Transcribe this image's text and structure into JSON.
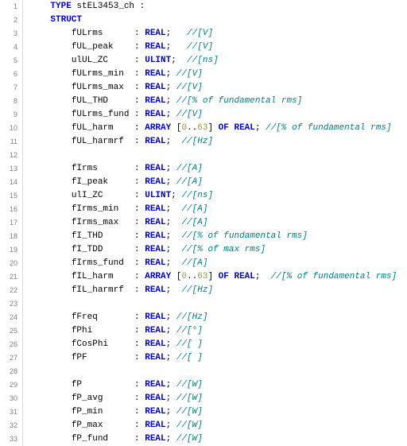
{
  "header": {
    "kw_type": "TYPE",
    "type_name": "stEL3453_ch",
    "colon": " :",
    "kw_struct": "STRUCT"
  },
  "lines": [
    {
      "name": "fULrms",
      "decl": ": ",
      "dtype": "REAL",
      "after": ";   ",
      "cmt": "//[V]"
    },
    {
      "name": "fUL_peak",
      "decl": ": ",
      "dtype": "REAL",
      "after": ";   ",
      "cmt": "//[V]"
    },
    {
      "name": "ulUL_ZC",
      "decl": ": ",
      "dtype": "ULINT",
      "after": ";  ",
      "cmt": "//[ns]"
    },
    {
      "name": "fULrms_min",
      "decl": ": ",
      "dtype": "REAL",
      "after": "; ",
      "cmt": "//[V]"
    },
    {
      "name": "fULrms_max",
      "decl": ": ",
      "dtype": "REAL",
      "after": "; ",
      "cmt": "//[V]"
    },
    {
      "name": "fUL_THD",
      "decl": ": ",
      "dtype": "REAL",
      "after": "; ",
      "cmt": "//[% of fundamental rms]"
    },
    {
      "name": "fULrms_fund",
      "decl": ": ",
      "dtype": "REAL",
      "after": "; ",
      "cmt": "//[V]"
    },
    {
      "name": "fUL_harm",
      "decl": ": ",
      "array": true,
      "arr_lo": "0",
      "arr_hi": "63",
      "arr_of": "REAL",
      "after": "; ",
      "cmt": "//[% of fundamental rms]"
    },
    {
      "name": "fUL_harmrf",
      "decl": ": ",
      "dtype": "REAL",
      "after": ";  ",
      "cmt": "//[Hz]"
    },
    {
      "blank": true
    },
    {
      "name": "fIrms",
      "decl": ": ",
      "dtype": "REAL",
      "after": "; ",
      "cmt": "//[A]"
    },
    {
      "name": "fI_peak",
      "decl": ": ",
      "dtype": "REAL",
      "after": "; ",
      "cmt": "//[A]"
    },
    {
      "name": "ulI_ZC",
      "decl": ": ",
      "dtype": "ULINT",
      "after": "; ",
      "cmt": "//[ns]"
    },
    {
      "name": "fIrms_min",
      "decl": ": ",
      "dtype": "REAL",
      "after": ";  ",
      "cmt": "//[A]"
    },
    {
      "name": "fIrms_max",
      "decl": ": ",
      "dtype": "REAL",
      "after": ";  ",
      "cmt": "//[A]"
    },
    {
      "name": "fI_THD",
      "decl": ": ",
      "dtype": "REAL",
      "after": ";  ",
      "cmt": "//[% of fundamental rms]"
    },
    {
      "name": "fI_TDD",
      "decl": ": ",
      "dtype": "REAL",
      "after": ";  ",
      "cmt": "//[% of max rms]"
    },
    {
      "name": "fIrms_fund",
      "decl": ": ",
      "dtype": "REAL",
      "after": ";  ",
      "cmt": "//[A]"
    },
    {
      "name": "fIL_harm",
      "decl": ": ",
      "array": true,
      "arr_lo": "0",
      "arr_hi": "63",
      "arr_of": "REAL",
      "after": ";  ",
      "cmt": "//[% of fundamental rms]"
    },
    {
      "name": "fIL_harmrf",
      "decl": ": ",
      "dtype": "REAL",
      "after": ";  ",
      "cmt": "//[Hz]"
    },
    {
      "blank": true
    },
    {
      "name": "fFreq",
      "decl": ": ",
      "dtype": "REAL",
      "after": "; ",
      "cmt": "//[Hz]"
    },
    {
      "name": "fPhi",
      "decl": ": ",
      "dtype": "REAL",
      "after": "; ",
      "cmt": "//[°]"
    },
    {
      "name": "fCosPhi",
      "decl": ": ",
      "dtype": "REAL",
      "after": "; ",
      "cmt": "//[ ]"
    },
    {
      "name": "fPF",
      "decl": ": ",
      "dtype": "REAL",
      "after": "; ",
      "cmt": "//[ ]"
    },
    {
      "blank": true
    },
    {
      "name": "fP",
      "decl": ": ",
      "dtype": "REAL",
      "after": "; ",
      "cmt": "//[W]"
    },
    {
      "name": "fP_avg",
      "decl": ": ",
      "dtype": "REAL",
      "after": "; ",
      "cmt": "//[W]"
    },
    {
      "name": "fP_min",
      "decl": ": ",
      "dtype": "REAL",
      "after": "; ",
      "cmt": "//[W]"
    },
    {
      "name": "fP_max",
      "decl": ": ",
      "dtype": "REAL",
      "after": "; ",
      "cmt": "//[W]"
    },
    {
      "name": "fP_fund",
      "decl": ": ",
      "dtype": "REAL",
      "after": "; ",
      "cmt": "//[W]"
    }
  ],
  "syntax": {
    "kw_array": "ARRAY",
    "kw_of": "OF",
    "lbracket": " [",
    "dotdot": "..",
    "rbracket": "] "
  },
  "layout": {
    "indent_struct": "    ",
    "indent_member": "        ",
    "name_col_width": 12,
    "total_lines": 33
  }
}
